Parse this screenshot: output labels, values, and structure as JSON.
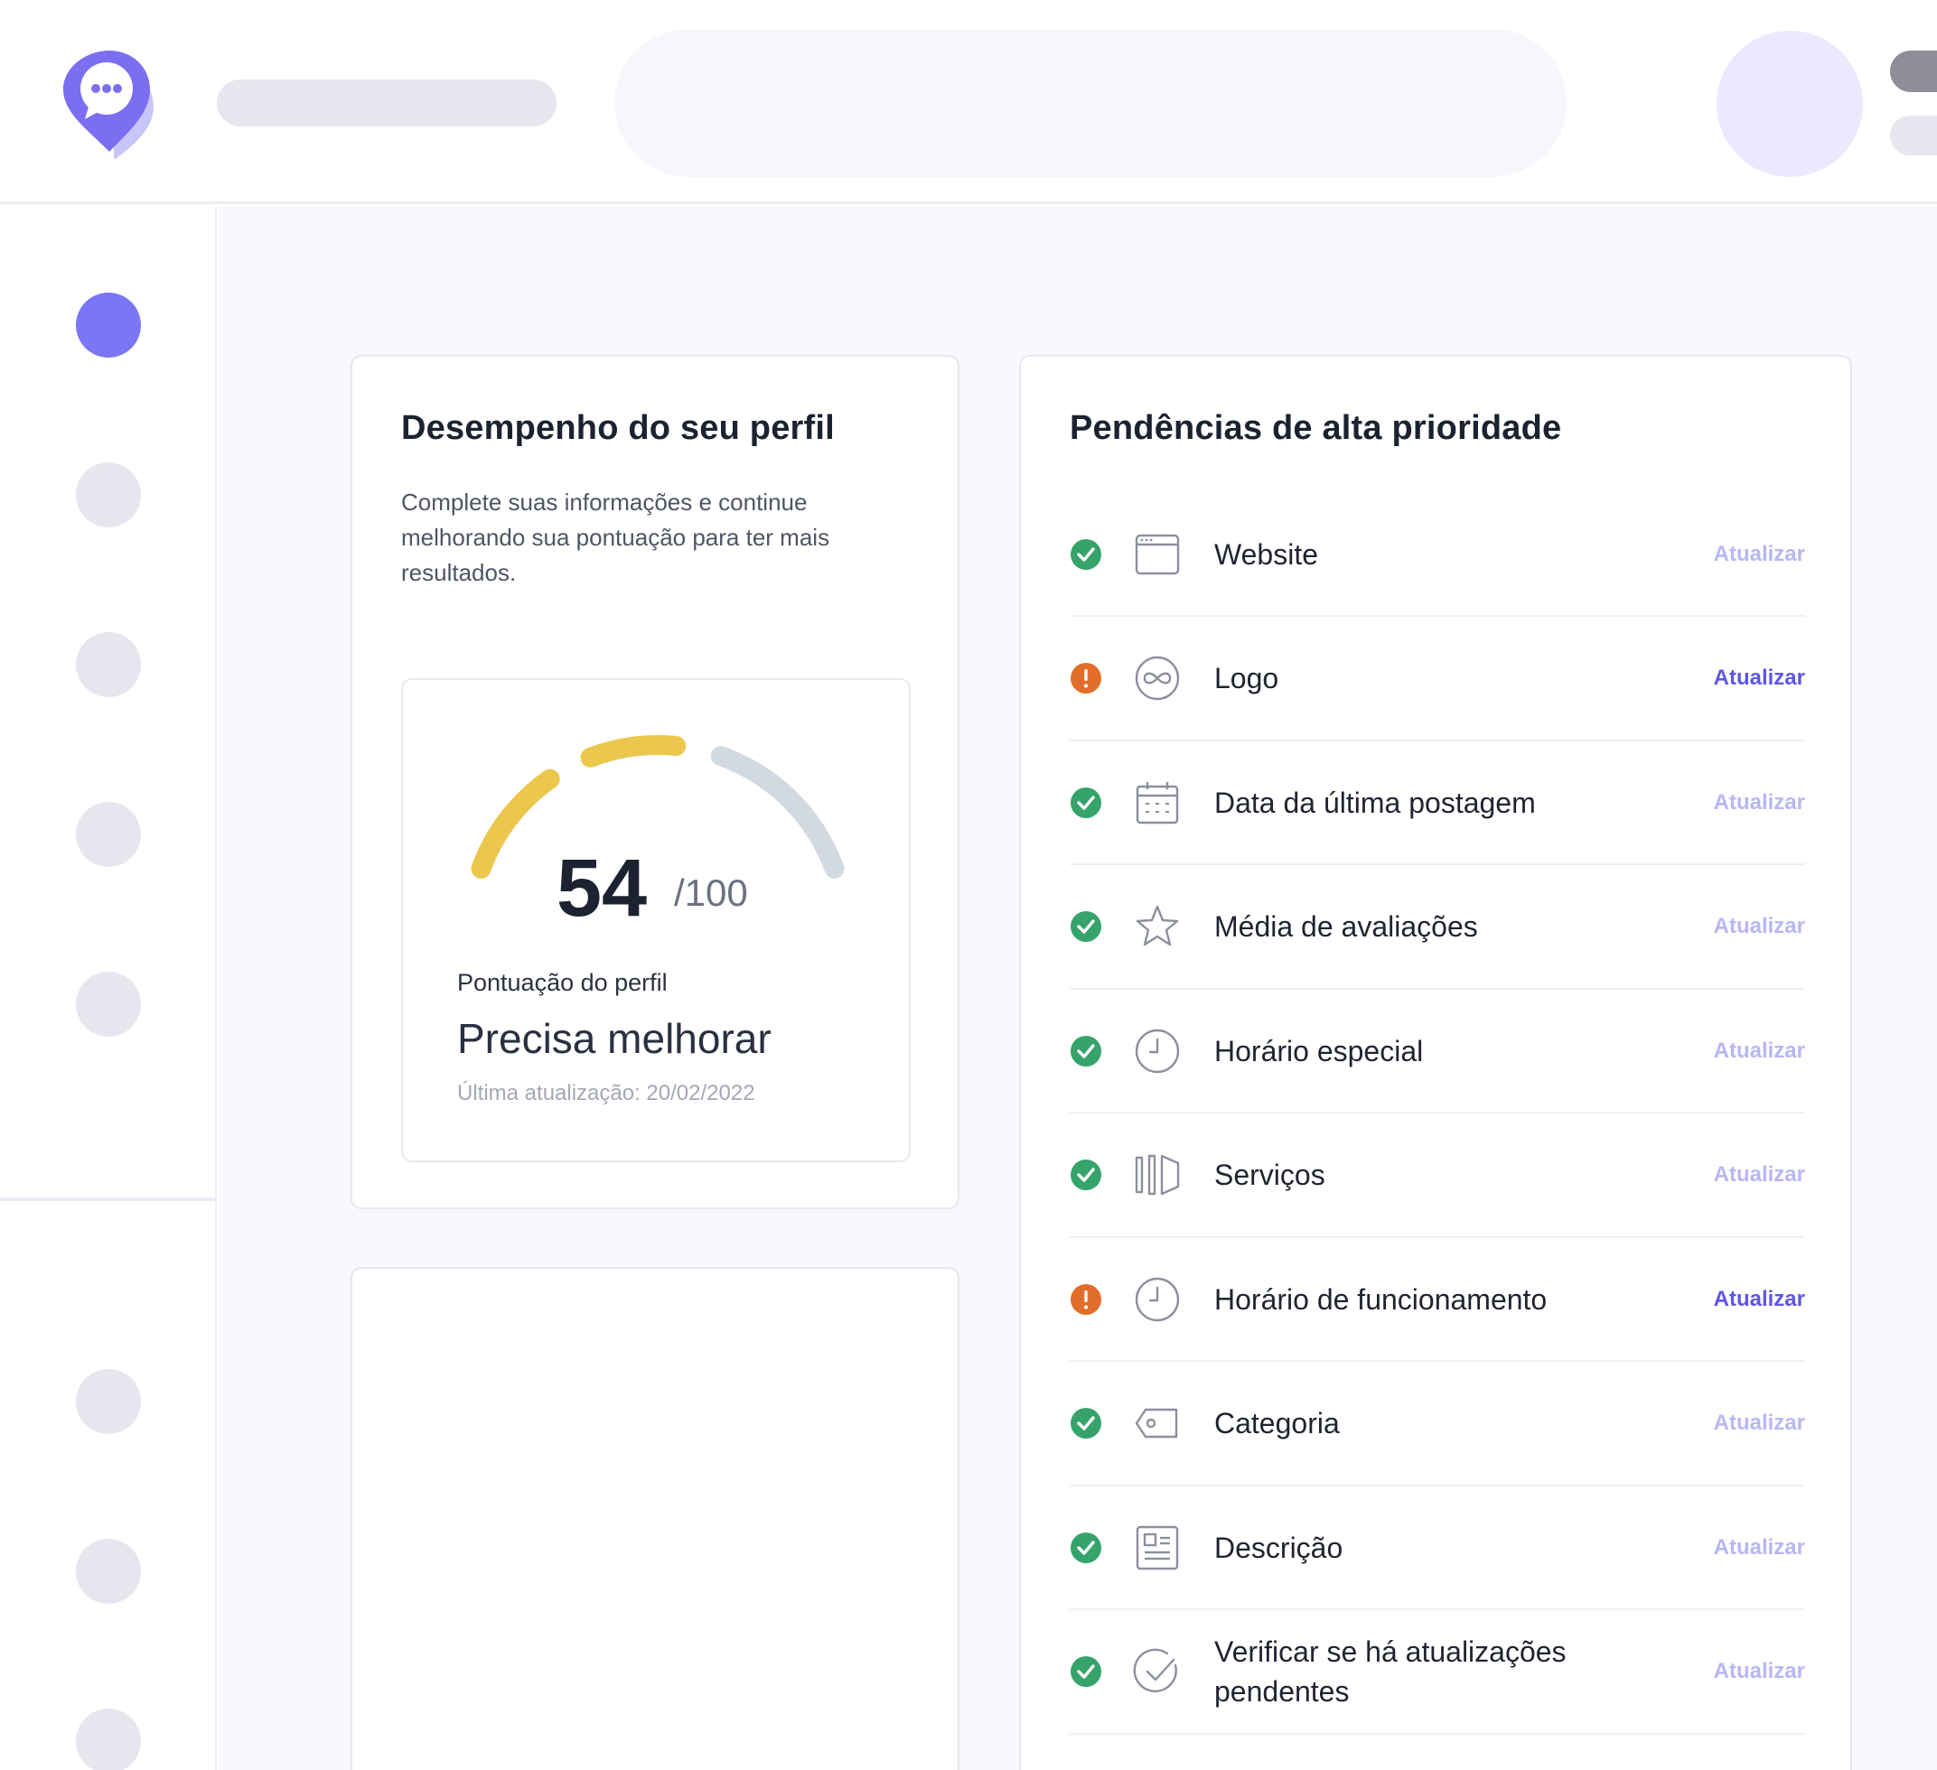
{
  "colors": {
    "accent": "#7b76f5",
    "gauge_fill": "#ecc74d",
    "gauge_track": "#d3d9e0",
    "ok": "#36a36a",
    "warning": "#e26d2a",
    "link_muted": "#b9b6f4",
    "link_active": "#5f55e6"
  },
  "performance": {
    "title": "Desempenho do seu perfil",
    "description": "Complete suas informações e continue melhorando sua pontuação para ter mais resultados.",
    "score": "54",
    "score_max": "/100",
    "score_fraction": 0.54,
    "score_label": "Pontuação do perfil",
    "status": "Precisa melhorar",
    "last_update": "Última atualização: 20/02/2022"
  },
  "pending": {
    "title": "Pendências de alta prioridade",
    "items": [
      {
        "label": "Website",
        "status": "ok",
        "icon": "browser-window-icon",
        "action": "Atualizar"
      },
      {
        "label": "Logo",
        "status": "warning",
        "icon": "infinity-logo-icon",
        "action": "Atualizar"
      },
      {
        "label": "Data da última postagem",
        "status": "ok",
        "icon": "calendar-icon",
        "action": "Atualizar"
      },
      {
        "label": "Média de avaliações",
        "status": "ok",
        "icon": "star-icon",
        "action": "Atualizar"
      },
      {
        "label": "Horário especial",
        "status": "ok",
        "icon": "clock-icon",
        "action": "Atualizar"
      },
      {
        "label": "Serviços",
        "status": "ok",
        "icon": "services-panels-icon",
        "action": "Atualizar"
      },
      {
        "label": "Horário de funcionamento",
        "status": "warning",
        "icon": "clock-icon",
        "action": "Atualizar"
      },
      {
        "label": "Categoria",
        "status": "ok",
        "icon": "tag-icon",
        "action": "Atualizar"
      },
      {
        "label": "Descrição",
        "status": "ok",
        "icon": "document-icon",
        "action": "Atualizar"
      },
      {
        "label": "Verificar se há atualizações pendentes",
        "status": "ok",
        "icon": "check-circle-icon",
        "action": "Atualizar"
      }
    ]
  }
}
